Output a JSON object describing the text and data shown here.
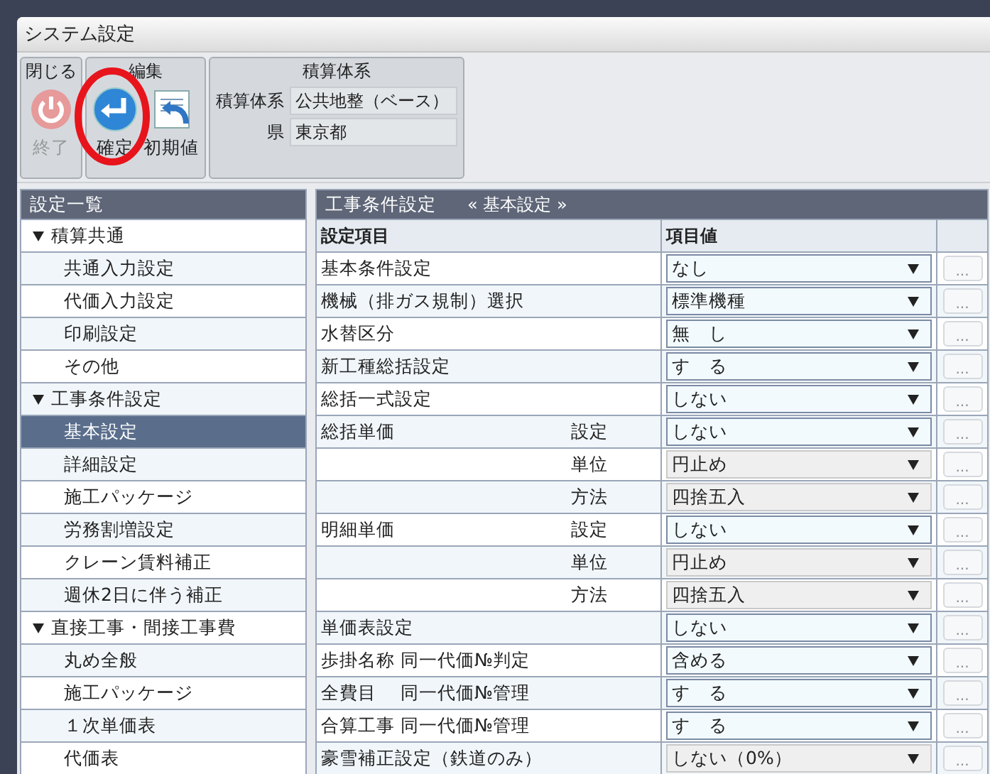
{
  "window": {
    "title": "システム設定"
  },
  "toolbar": {
    "groups": [
      {
        "title": "閉じる",
        "buttons": [
          {
            "label": "終了",
            "kind": "power",
            "disabled": true,
            "highlighted": false
          }
        ]
      },
      {
        "title": "編集",
        "buttons": [
          {
            "label": "確定",
            "kind": "enter",
            "disabled": false,
            "highlighted": true
          },
          {
            "label": "初期値",
            "kind": "reset",
            "disabled": false,
            "highlighted": false
          }
        ]
      }
    ],
    "info": {
      "title": "積算体系",
      "fields": [
        {
          "label": "積算体系",
          "value": "公共地整（ベース）"
        },
        {
          "label": "県",
          "value": "東京都"
        }
      ]
    }
  },
  "sidebar": {
    "title": "設定一覧",
    "groups": [
      {
        "label": "積算共通",
        "expanded": true,
        "children": [
          {
            "label": "共通入力設定",
            "selected": false
          },
          {
            "label": "代価入力設定",
            "selected": false
          },
          {
            "label": "印刷設定",
            "selected": false
          },
          {
            "label": "その他",
            "selected": false
          }
        ]
      },
      {
        "label": "工事条件設定",
        "expanded": true,
        "children": [
          {
            "label": "基本設定",
            "selected": true
          },
          {
            "label": "詳細設定",
            "selected": false
          },
          {
            "label": "施工パッケージ",
            "selected": false
          },
          {
            "label": "労務割増設定",
            "selected": false
          },
          {
            "label": "クレーン賃料補正",
            "selected": false
          },
          {
            "label": "週休2日に伴う補正",
            "selected": false
          }
        ]
      },
      {
        "label": "直接工事・間接工事費",
        "expanded": true,
        "children": [
          {
            "label": "丸め全般",
            "selected": false
          },
          {
            "label": "施工パッケージ",
            "selected": false
          },
          {
            "label": "１次単価表",
            "selected": false
          },
          {
            "label": "代価表",
            "selected": false
          }
        ]
      }
    ]
  },
  "panel": {
    "title": "工事条件設定",
    "subtitle": "« 基本設定 »",
    "columns": [
      "設定項目",
      "項目値"
    ],
    "rows": [
      {
        "label": "基本条件設定",
        "value": "なし",
        "disabled": false,
        "button": "..."
      },
      {
        "label": "機械（排ガス規制）選択",
        "value": "標準機種",
        "disabled": false,
        "button": "..."
      },
      {
        "label": "水替区分",
        "value": "無　し",
        "disabled": false,
        "button": "..."
      },
      {
        "label": "新工種総括設定",
        "value": "す　る",
        "disabled": false,
        "button": "..."
      },
      {
        "label": "総括一式設定",
        "value": "しない",
        "disabled": false,
        "button": "..."
      },
      {
        "label": "総括単価",
        "sub": "設定",
        "value": "しない",
        "disabled": false,
        "button": "..."
      },
      {
        "sub": "単位",
        "value": "円止め",
        "disabled": true,
        "button": "..."
      },
      {
        "sub": "方法",
        "value": "四捨五入",
        "disabled": true,
        "button": "..."
      },
      {
        "label": "明細単価",
        "sub": "設定",
        "value": "しない",
        "disabled": false,
        "button": "..."
      },
      {
        "sub": "単位",
        "value": "円止め",
        "disabled": true,
        "button": "..."
      },
      {
        "sub": "方法",
        "value": "四捨五入",
        "disabled": true,
        "button": "..."
      },
      {
        "label": "単価表設定",
        "value": "しない",
        "disabled": false,
        "button": "..."
      },
      {
        "label": "歩掛名称 同一代価№判定",
        "value": "含める",
        "disabled": false,
        "button": "..."
      },
      {
        "label": "全費目　 同一代価№管理",
        "value": "す　る",
        "disabled": false,
        "button": "..."
      },
      {
        "label": "合算工事 同一代価№管理",
        "value": "す　る",
        "disabled": false,
        "button": "..."
      },
      {
        "label": "豪雪補正設定（鉄道のみ）",
        "value": "しない（0%）",
        "disabled": true,
        "button": "..."
      }
    ]
  }
}
